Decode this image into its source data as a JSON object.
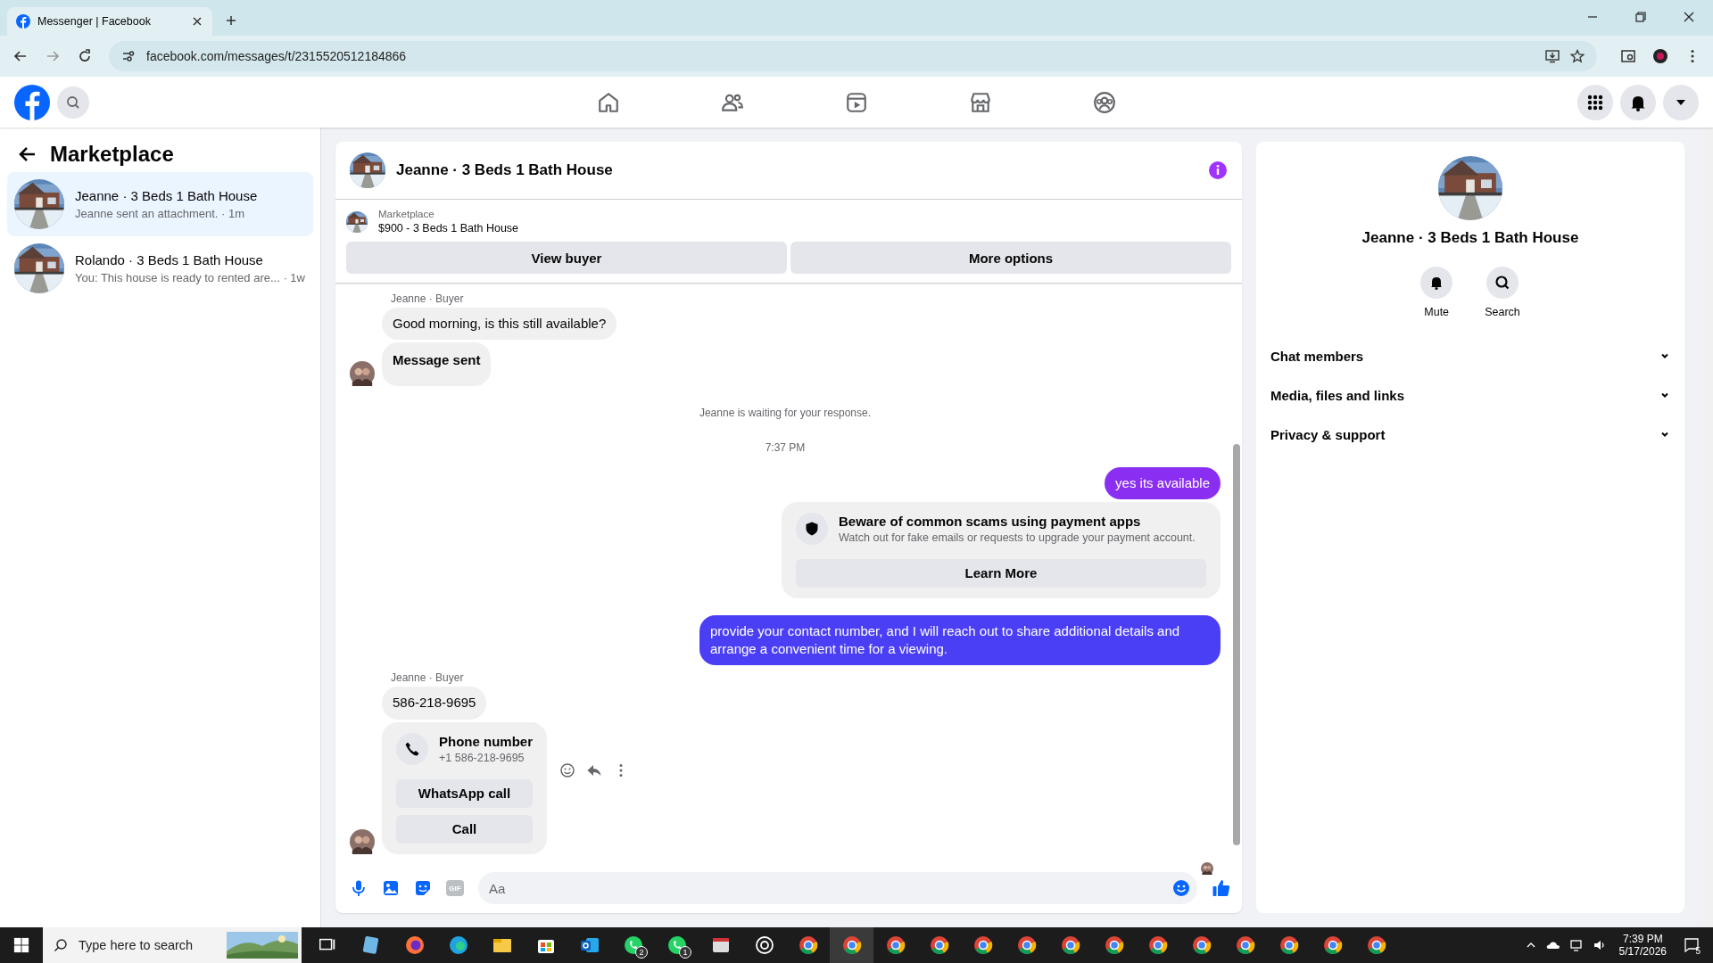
{
  "browser": {
    "tab_title": "Messenger | Facebook",
    "url": "facebook.com/messages/t/2315520512184866"
  },
  "left_panel": {
    "title": "Marketplace",
    "conversations": [
      {
        "name": "Jeanne · 3 Beds 1 Bath House",
        "preview": "Jeanne sent an attachment. · 1m",
        "selected": true
      },
      {
        "name": "Rolando · 3 Beds 1 Bath House",
        "preview": "You: This house is ready to rented are... · 1w",
        "selected": false
      }
    ]
  },
  "chat": {
    "title": "Jeanne · 3 Beds 1 Bath House",
    "listing": {
      "label": "Marketplace",
      "title": "$900 - 3 Beds 1 Bath House"
    },
    "buttons": [
      "View buyer",
      "More options"
    ],
    "messages": [
      {
        "kind": "sender",
        "text": "Jeanne · Buyer"
      },
      {
        "kind": "incoming",
        "text": "Good morning, is this still available?",
        "avatar": false
      },
      {
        "kind": "notice",
        "text": "Message sent",
        "avatar": true
      },
      {
        "kind": "status",
        "text": "Jeanne is waiting for your response."
      },
      {
        "kind": "time",
        "text": "7:37 PM"
      },
      {
        "kind": "outgoing",
        "text": "yes its available",
        "color": "#8a2ff2"
      },
      {
        "kind": "warning",
        "title": "Beware of common scams using payment apps",
        "text": "Watch out for fake emails or requests to upgrade your payment account.",
        "button": "Learn More"
      },
      {
        "kind": "outgoing",
        "text": "provide your contact number, and I will reach out to share additional details and arrange a convenient time for a viewing.",
        "color": "#4b3ff6"
      },
      {
        "kind": "sender",
        "text": "Jeanne · Buyer"
      },
      {
        "kind": "incoming",
        "text": "586-218-9695",
        "avatar": false
      },
      {
        "kind": "contact",
        "title": "Phone number",
        "number": "+1 586-218-9695",
        "buttons": [
          "WhatsApp call",
          "Call"
        ],
        "avatar": true
      }
    ],
    "composer": {
      "placeholder": "Aa",
      "gif_label": "GIF"
    }
  },
  "right_panel": {
    "name": "Jeanne · 3 Beds 1 Bath House",
    "actions": [
      {
        "kind": "mute",
        "label": "Mute"
      },
      {
        "kind": "search",
        "label": "Search"
      }
    ],
    "sections": [
      {
        "label": "Chat members",
        "expanded": false
      },
      {
        "label": "Media, files and links",
        "expanded": false
      },
      {
        "label": "Privacy & support",
        "expanded": false
      }
    ]
  },
  "taskbar": {
    "search_placeholder": "Type here to search",
    "apps": [
      {
        "kind": "taskview",
        "selected": false
      },
      {
        "kind": "notepad",
        "selected": false
      },
      {
        "kind": "firefox",
        "selected": false
      },
      {
        "kind": "edge",
        "selected": false
      },
      {
        "kind": "files",
        "selected": false
      },
      {
        "kind": "store",
        "selected": false
      },
      {
        "kind": "outlook",
        "selected": false
      },
      {
        "kind": "whatsapp",
        "badge": "2",
        "selected": false
      },
      {
        "kind": "whatsapp",
        "badge": "1",
        "selected": false
      },
      {
        "kind": "window",
        "selected": false
      },
      {
        "kind": "chatgpt",
        "selected": false
      },
      {
        "kind": "chrome",
        "selected": false
      },
      {
        "kind": "chrome",
        "selected": true
      },
      {
        "kind": "chrome",
        "selected": false
      },
      {
        "kind": "chrome",
        "selected": false
      },
      {
        "kind": "chrome",
        "selected": false
      },
      {
        "kind": "chrome",
        "selected": false
      },
      {
        "kind": "chrome",
        "selected": false
      },
      {
        "kind": "chrome",
        "selected": false
      },
      {
        "kind": "chrome",
        "selected": false
      },
      {
        "kind": "chrome",
        "selected": false
      },
      {
        "kind": "chrome",
        "selected": false
      },
      {
        "kind": "chrome",
        "selected": false
      },
      {
        "kind": "chrome",
        "selected": false
      },
      {
        "kind": "chrome",
        "selected": false
      }
    ],
    "time": "7:39 PM",
    "date": "5/17/2026",
    "notifications": "5"
  }
}
